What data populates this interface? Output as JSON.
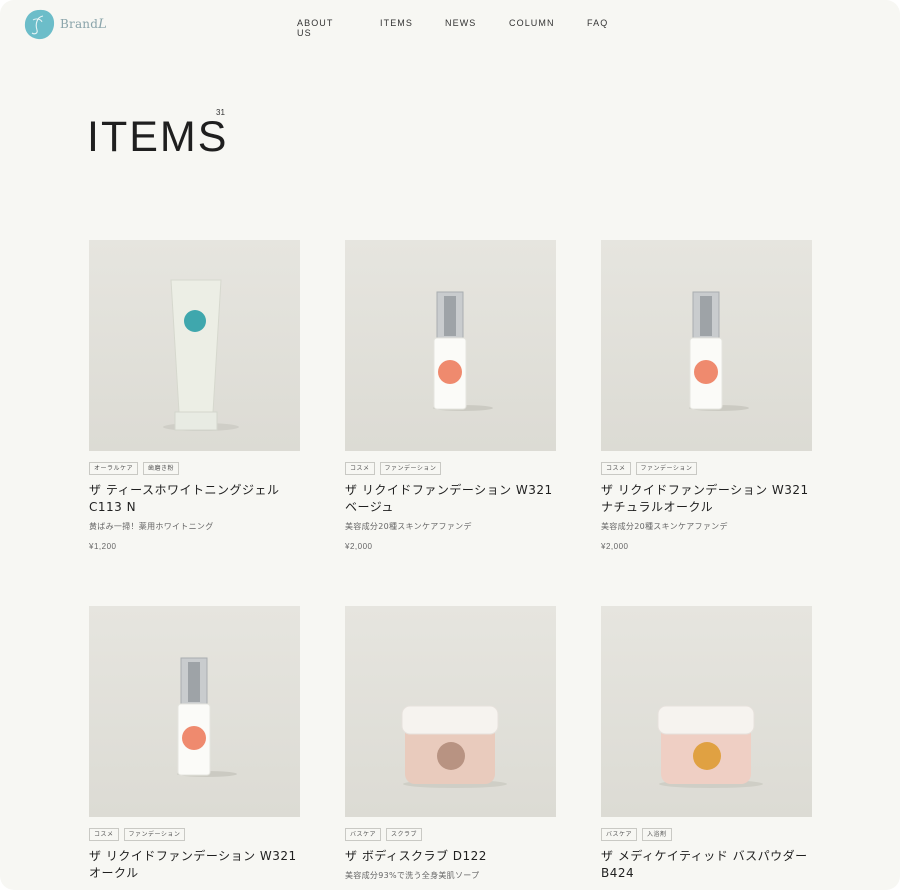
{
  "header": {
    "logo_text": "Brand",
    "logo_swash": "L",
    "nav": [
      "ABOUT US",
      "ITEMS",
      "NEWS",
      "COLUMN",
      "FAQ"
    ]
  },
  "main": {
    "title": "ITEMS",
    "count": "31"
  },
  "products": [
    {
      "tags": [
        "オーラルケア",
        "歯磨き粉"
      ],
      "name": "ザ ティースホワイトニングジェル C113 N",
      "desc": "黄ばみ一掃！薬用ホワイトニング",
      "price": "¥1,200",
      "image": "tube",
      "dot_color": "#3fa7ad"
    },
    {
      "tags": [
        "コスメ",
        "ファンデーション"
      ],
      "name": "ザ リクイドファンデーション W321 ベージュ",
      "desc": "美容成分20種スキンケアファンデ",
      "price": "¥2,000",
      "image": "pump",
      "dot_color": "#ef8a6e"
    },
    {
      "tags": [
        "コスメ",
        "ファンデーション"
      ],
      "name": "ザ リクイドファンデーション W321 ナチュラルオークル",
      "desc": "美容成分20種スキンケアファンデ",
      "price": "¥2,000",
      "image": "pump",
      "dot_color": "#ef8a6e"
    },
    {
      "tags": [
        "コスメ",
        "ファンデーション"
      ],
      "name": "ザ リクイドファンデーション W321 オークル",
      "desc": "",
      "price": "",
      "image": "pump",
      "dot_color": "#ef8a6e"
    },
    {
      "tags": [
        "バスケア",
        "スクラブ"
      ],
      "name": "ザ ボディスクラブ D122",
      "desc": "美容成分93%で洗う全身美肌ソープ",
      "price": "",
      "image": "jar",
      "dot_color": "#b89382",
      "jar_color": "#e9cbbd"
    },
    {
      "tags": [
        "バスケア",
        "入浴剤"
      ],
      "name": "ザ メディケイティッド バスパウダー B424",
      "desc": "",
      "price": "",
      "image": "jar",
      "dot_color": "#e0a142",
      "jar_color": "#efcfc4"
    }
  ],
  "colors": {
    "background": "#f7f7f3",
    "logo": "#5cb6c4",
    "photo_bg": "#e4e3dd"
  }
}
